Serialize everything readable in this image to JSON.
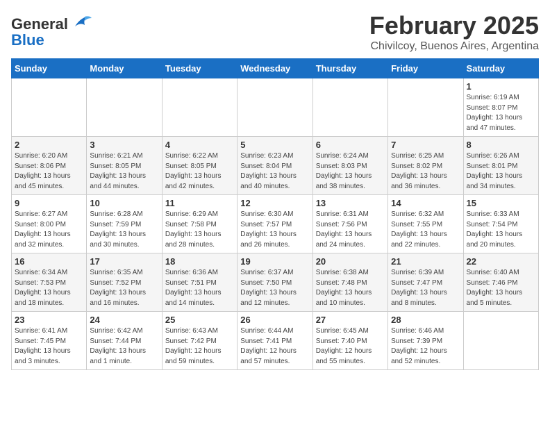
{
  "header": {
    "logo_general": "General",
    "logo_blue": "Blue",
    "month_year": "February 2025",
    "location": "Chivilcoy, Buenos Aires, Argentina"
  },
  "weekdays": [
    "Sunday",
    "Monday",
    "Tuesday",
    "Wednesday",
    "Thursday",
    "Friday",
    "Saturday"
  ],
  "weeks": [
    [
      {
        "day": "",
        "info": ""
      },
      {
        "day": "",
        "info": ""
      },
      {
        "day": "",
        "info": ""
      },
      {
        "day": "",
        "info": ""
      },
      {
        "day": "",
        "info": ""
      },
      {
        "day": "",
        "info": ""
      },
      {
        "day": "1",
        "info": "Sunrise: 6:19 AM\nSunset: 8:07 PM\nDaylight: 13 hours\nand 47 minutes."
      }
    ],
    [
      {
        "day": "2",
        "info": "Sunrise: 6:20 AM\nSunset: 8:06 PM\nDaylight: 13 hours\nand 45 minutes."
      },
      {
        "day": "3",
        "info": "Sunrise: 6:21 AM\nSunset: 8:05 PM\nDaylight: 13 hours\nand 44 minutes."
      },
      {
        "day": "4",
        "info": "Sunrise: 6:22 AM\nSunset: 8:05 PM\nDaylight: 13 hours\nand 42 minutes."
      },
      {
        "day": "5",
        "info": "Sunrise: 6:23 AM\nSunset: 8:04 PM\nDaylight: 13 hours\nand 40 minutes."
      },
      {
        "day": "6",
        "info": "Sunrise: 6:24 AM\nSunset: 8:03 PM\nDaylight: 13 hours\nand 38 minutes."
      },
      {
        "day": "7",
        "info": "Sunrise: 6:25 AM\nSunset: 8:02 PM\nDaylight: 13 hours\nand 36 minutes."
      },
      {
        "day": "8",
        "info": "Sunrise: 6:26 AM\nSunset: 8:01 PM\nDaylight: 13 hours\nand 34 minutes."
      }
    ],
    [
      {
        "day": "9",
        "info": "Sunrise: 6:27 AM\nSunset: 8:00 PM\nDaylight: 13 hours\nand 32 minutes."
      },
      {
        "day": "10",
        "info": "Sunrise: 6:28 AM\nSunset: 7:59 PM\nDaylight: 13 hours\nand 30 minutes."
      },
      {
        "day": "11",
        "info": "Sunrise: 6:29 AM\nSunset: 7:58 PM\nDaylight: 13 hours\nand 28 minutes."
      },
      {
        "day": "12",
        "info": "Sunrise: 6:30 AM\nSunset: 7:57 PM\nDaylight: 13 hours\nand 26 minutes."
      },
      {
        "day": "13",
        "info": "Sunrise: 6:31 AM\nSunset: 7:56 PM\nDaylight: 13 hours\nand 24 minutes."
      },
      {
        "day": "14",
        "info": "Sunrise: 6:32 AM\nSunset: 7:55 PM\nDaylight: 13 hours\nand 22 minutes."
      },
      {
        "day": "15",
        "info": "Sunrise: 6:33 AM\nSunset: 7:54 PM\nDaylight: 13 hours\nand 20 minutes."
      }
    ],
    [
      {
        "day": "16",
        "info": "Sunrise: 6:34 AM\nSunset: 7:53 PM\nDaylight: 13 hours\nand 18 minutes."
      },
      {
        "day": "17",
        "info": "Sunrise: 6:35 AM\nSunset: 7:52 PM\nDaylight: 13 hours\nand 16 minutes."
      },
      {
        "day": "18",
        "info": "Sunrise: 6:36 AM\nSunset: 7:51 PM\nDaylight: 13 hours\nand 14 minutes."
      },
      {
        "day": "19",
        "info": "Sunrise: 6:37 AM\nSunset: 7:50 PM\nDaylight: 13 hours\nand 12 minutes."
      },
      {
        "day": "20",
        "info": "Sunrise: 6:38 AM\nSunset: 7:48 PM\nDaylight: 13 hours\nand 10 minutes."
      },
      {
        "day": "21",
        "info": "Sunrise: 6:39 AM\nSunset: 7:47 PM\nDaylight: 13 hours\nand 8 minutes."
      },
      {
        "day": "22",
        "info": "Sunrise: 6:40 AM\nSunset: 7:46 PM\nDaylight: 13 hours\nand 5 minutes."
      }
    ],
    [
      {
        "day": "23",
        "info": "Sunrise: 6:41 AM\nSunset: 7:45 PM\nDaylight: 13 hours\nand 3 minutes."
      },
      {
        "day": "24",
        "info": "Sunrise: 6:42 AM\nSunset: 7:44 PM\nDaylight: 13 hours\nand 1 minute."
      },
      {
        "day": "25",
        "info": "Sunrise: 6:43 AM\nSunset: 7:42 PM\nDaylight: 12 hours\nand 59 minutes."
      },
      {
        "day": "26",
        "info": "Sunrise: 6:44 AM\nSunset: 7:41 PM\nDaylight: 12 hours\nand 57 minutes."
      },
      {
        "day": "27",
        "info": "Sunrise: 6:45 AM\nSunset: 7:40 PM\nDaylight: 12 hours\nand 55 minutes."
      },
      {
        "day": "28",
        "info": "Sunrise: 6:46 AM\nSunset: 7:39 PM\nDaylight: 12 hours\nand 52 minutes."
      },
      {
        "day": "",
        "info": ""
      }
    ]
  ]
}
